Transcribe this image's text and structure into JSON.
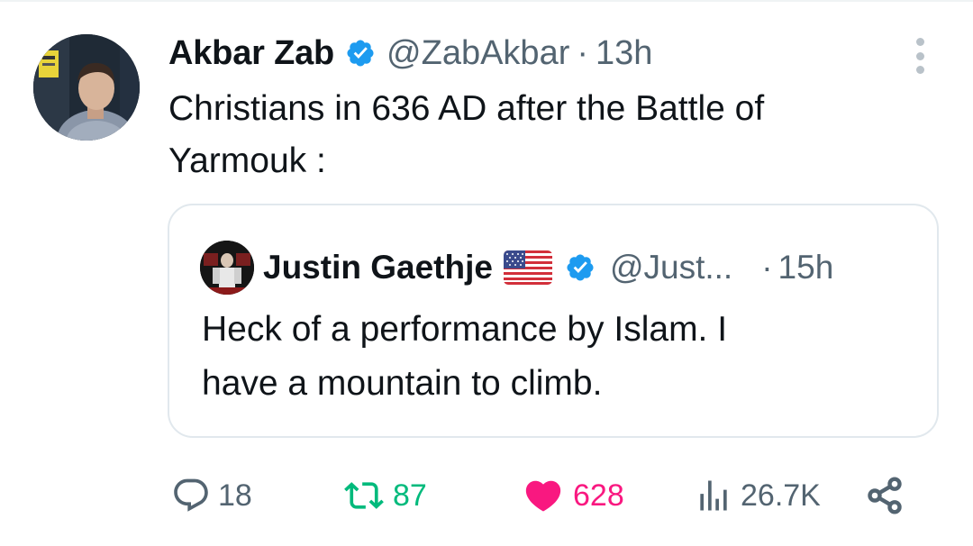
{
  "author": {
    "display_name": "Akbar Zab",
    "handle": "@ZabAkbar",
    "separator": "·",
    "time": "13h",
    "verified_icon": "verified-badge-icon",
    "avatar_icon": "avatar"
  },
  "tweet": {
    "text_line1": "Christians in 636 AD after the Battle of",
    "text_line2": "Yarmouk :"
  },
  "quoted": {
    "display_name": "Justin Gaethje",
    "flag_icon": "us-flag-icon",
    "handle": "@Just...",
    "separator": "·",
    "time": "15h",
    "text_line1": "Heck of a performance by Islam. I",
    "text_line2": "have a mountain to climb."
  },
  "actions": {
    "replies": "18",
    "reposts": "87",
    "likes": "628",
    "views": "26.7K"
  },
  "colors": {
    "verified_blue": "#1d9bf0",
    "secondary_text": "#536471",
    "repost_green": "#00ba7c",
    "like_pink": "#f91880",
    "primary_text": "#0f1419",
    "border": "#e1e8ed"
  }
}
